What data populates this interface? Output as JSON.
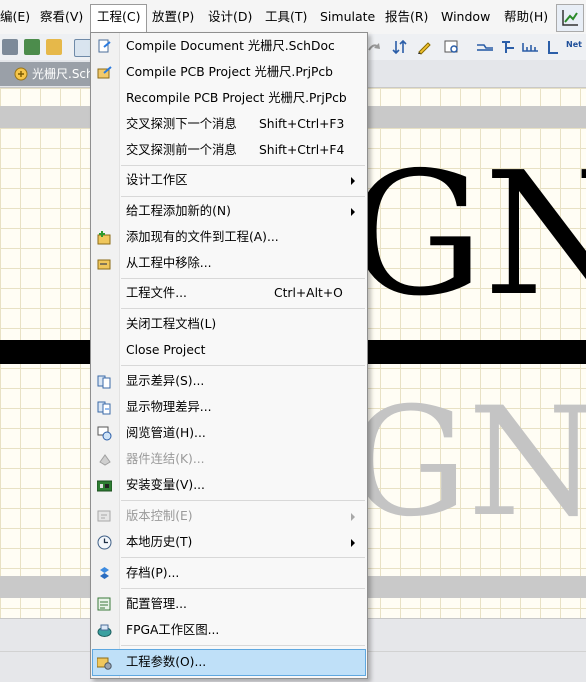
{
  "menubar": {
    "items": [
      {
        "label": "编(E)"
      },
      {
        "label": "察看(V)"
      },
      {
        "label": "工程(C)"
      },
      {
        "label": "放置(P)"
      },
      {
        "label": "设计(D)"
      },
      {
        "label": "工具(T)"
      },
      {
        "label": "Simulate"
      },
      {
        "label": "报告(R)"
      },
      {
        "label": "Window"
      },
      {
        "label": "帮助(H)"
      }
    ]
  },
  "toolbar": {
    "icons": [
      "layers-icon",
      "save-icon",
      "folder-icon",
      "zoom-icon",
      "redo-icon",
      "sort-icon",
      "pencil-icon",
      "inspect-icon",
      "wire-icon",
      "bus-icon",
      "net-label-icon",
      "port-icon",
      "net-text-icon",
      "check-icon"
    ],
    "net_label": "Net"
  },
  "document_tab": {
    "label": "光栅尺.Sch",
    "icon": "schematic-doc-icon"
  },
  "canvas": {
    "large_text_black": "GN",
    "large_text_gray": "GN"
  },
  "project_menu": {
    "items": [
      {
        "label": "Compile Document 光栅尺.SchDoc",
        "shortcut": "",
        "icon": "compile-doc-icon",
        "submenu": false,
        "disabled": false
      },
      {
        "label": "Compile PCB Project 光栅尺.PrjPcb",
        "shortcut": "",
        "icon": "compile-project-icon",
        "submenu": false,
        "disabled": false
      },
      {
        "label": "Recompile PCB Project 光栅尺.PrjPcb",
        "shortcut": "",
        "icon": "",
        "submenu": false,
        "disabled": false
      },
      {
        "label": "交叉探测下一个消息",
        "shortcut": "Shift+Ctrl+F3",
        "icon": "",
        "submenu": false,
        "disabled": false
      },
      {
        "label": "交叉探测前一个消息",
        "shortcut": "Shift+Ctrl+F4",
        "icon": "",
        "submenu": false,
        "disabled": false
      },
      {
        "label": "设计工作区",
        "shortcut": "",
        "icon": "",
        "submenu": true,
        "disabled": false
      },
      {
        "label": "给工程添加新的(N)",
        "shortcut": "",
        "icon": "",
        "submenu": true,
        "disabled": false
      },
      {
        "label": "添加现有的文件到工程(A)...",
        "shortcut": "",
        "icon": "add-file-icon",
        "submenu": false,
        "disabled": false
      },
      {
        "label": "从工程中移除...",
        "shortcut": "",
        "icon": "remove-file-icon",
        "submenu": false,
        "disabled": false
      },
      {
        "label": "工程文件...",
        "shortcut": "Ctrl+Alt+O",
        "icon": "",
        "submenu": false,
        "disabled": false
      },
      {
        "label": "关闭工程文档(L)",
        "shortcut": "",
        "icon": "",
        "submenu": false,
        "disabled": false
      },
      {
        "label": "Close Project",
        "shortcut": "",
        "icon": "",
        "submenu": false,
        "disabled": false
      },
      {
        "label": "显示差异(S)...",
        "shortcut": "",
        "icon": "show-diff-icon",
        "submenu": false,
        "disabled": false
      },
      {
        "label": "显示物理差异...",
        "shortcut": "",
        "icon": "physical-diff-icon",
        "submenu": false,
        "disabled": false
      },
      {
        "label": "阅览管道(H)...",
        "shortcut": "",
        "icon": "channel-view-icon",
        "submenu": false,
        "disabled": false
      },
      {
        "label": "器件连结(K)...",
        "shortcut": "",
        "icon": "component-link-icon",
        "submenu": false,
        "disabled": true
      },
      {
        "label": "安装变量(V)...",
        "shortcut": "",
        "icon": "variants-icon",
        "submenu": false,
        "disabled": false
      },
      {
        "label": "版本控制(E)",
        "shortcut": "",
        "icon": "version-control-icon",
        "submenu": true,
        "disabled": true
      },
      {
        "label": "本地历史(T)",
        "shortcut": "",
        "icon": "history-clock-icon",
        "submenu": true,
        "disabled": false
      },
      {
        "label": "存档(P)...",
        "shortcut": "",
        "icon": "archive-icon",
        "submenu": false,
        "disabled": false
      },
      {
        "label": "配置管理...",
        "shortcut": "",
        "icon": "config-manager-icon",
        "submenu": false,
        "disabled": false
      },
      {
        "label": "FPGA工作区图...",
        "shortcut": "",
        "icon": "fpga-workspace-icon",
        "submenu": false,
        "disabled": false
      },
      {
        "label": "工程参数(O)...",
        "shortcut": "",
        "icon": "project-options-icon",
        "submenu": false,
        "disabled": false,
        "highlighted": true
      }
    ]
  },
  "colors": {
    "highlight": "#bfe0f8",
    "highlight_border": "#5fa8e0",
    "canvas_bg": "#fffdf4",
    "grid": "#e8e1c4"
  }
}
